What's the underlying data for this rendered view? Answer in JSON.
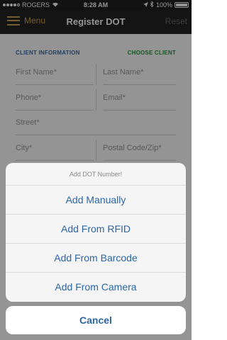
{
  "status": {
    "carrier": "ROGERS",
    "time": "8:28 AM",
    "battery": "100%"
  },
  "nav": {
    "menu_label": "Menu",
    "title": "Register DOT",
    "reset_label": "Reset"
  },
  "section": {
    "client_info": "CLIENT INFORMATION",
    "choose_client": "CHOOSE CLIENT"
  },
  "form": {
    "first_name": "First Name*",
    "last_name": "Last Name*",
    "phone": "Phone*",
    "email": "Email*",
    "street": "Street*",
    "city": "City*",
    "postal": "Postal Code/Zip*"
  },
  "sheet": {
    "title": "Add DOT Number!",
    "items": [
      "Add Manually",
      "Add From RFID",
      "Add From Barcode",
      "Add From Camera"
    ],
    "cancel": "Cancel"
  },
  "colors": {
    "accent_gold": "#c9a24a",
    "link_blue": "#2b66a8",
    "choose_green": "#2f8f48"
  }
}
